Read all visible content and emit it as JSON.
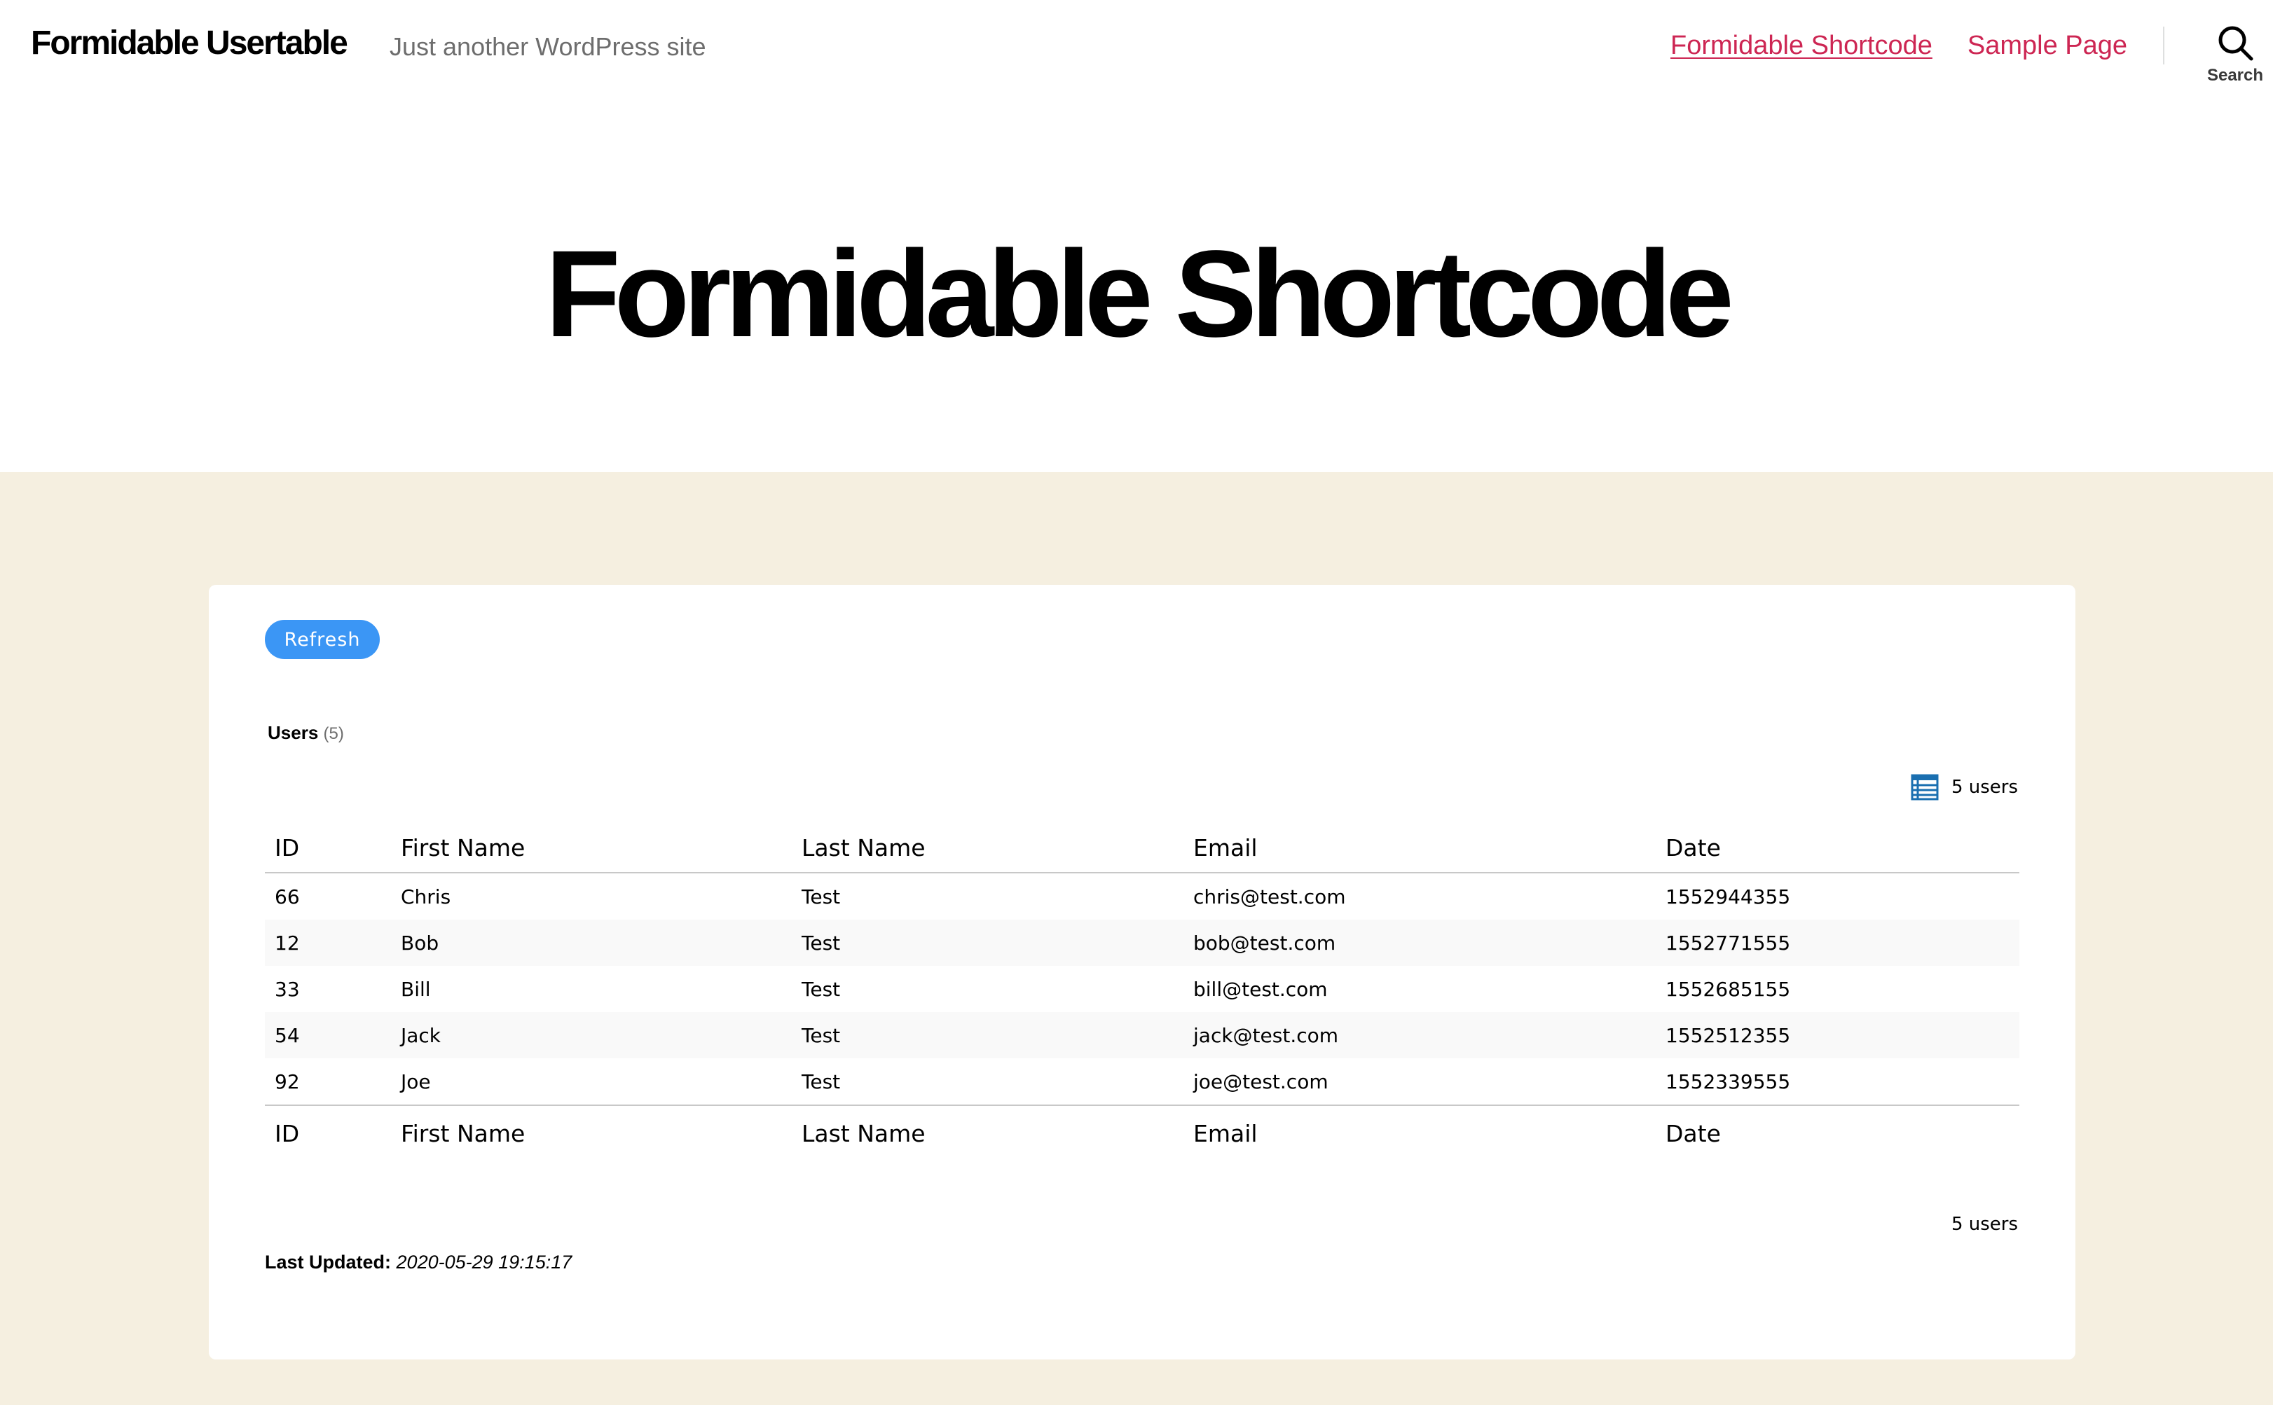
{
  "site": {
    "title": "Formidable Usertable",
    "tagline": "Just another WordPress site"
  },
  "nav": {
    "items": [
      {
        "label": "Formidable Shortcode",
        "current": true
      },
      {
        "label": "Sample Page",
        "current": false
      }
    ],
    "search_label": "Search",
    "link_color": "#cd2653"
  },
  "page": {
    "title": "Formidable Shortcode",
    "content_background": "#f5efe0"
  },
  "widget": {
    "refresh_label": "Refresh",
    "refresh_color": "#3b96f5",
    "heading": "Users",
    "heading_count": "(5)",
    "top_count": "5 users",
    "bottom_count": "5 users",
    "last_updated_label": "Last Updated:",
    "last_updated_value": "2020-05-29 19:15:17",
    "table_icon": "table-list-icon"
  },
  "table": {
    "columns": [
      "ID",
      "First Name",
      "Last Name",
      "Email",
      "Date"
    ],
    "rows": [
      [
        "66",
        "Chris",
        "Test",
        "chris@test.com",
        "1552944355"
      ],
      [
        "12",
        "Bob",
        "Test",
        "bob@test.com",
        "1552771555"
      ],
      [
        "33",
        "Bill",
        "Test",
        "bill@test.com",
        "1552685155"
      ],
      [
        "54",
        "Jack",
        "Test",
        "jack@test.com",
        "1552512355"
      ],
      [
        "92",
        "Joe",
        "Test",
        "joe@test.com",
        "1552339555"
      ]
    ]
  }
}
